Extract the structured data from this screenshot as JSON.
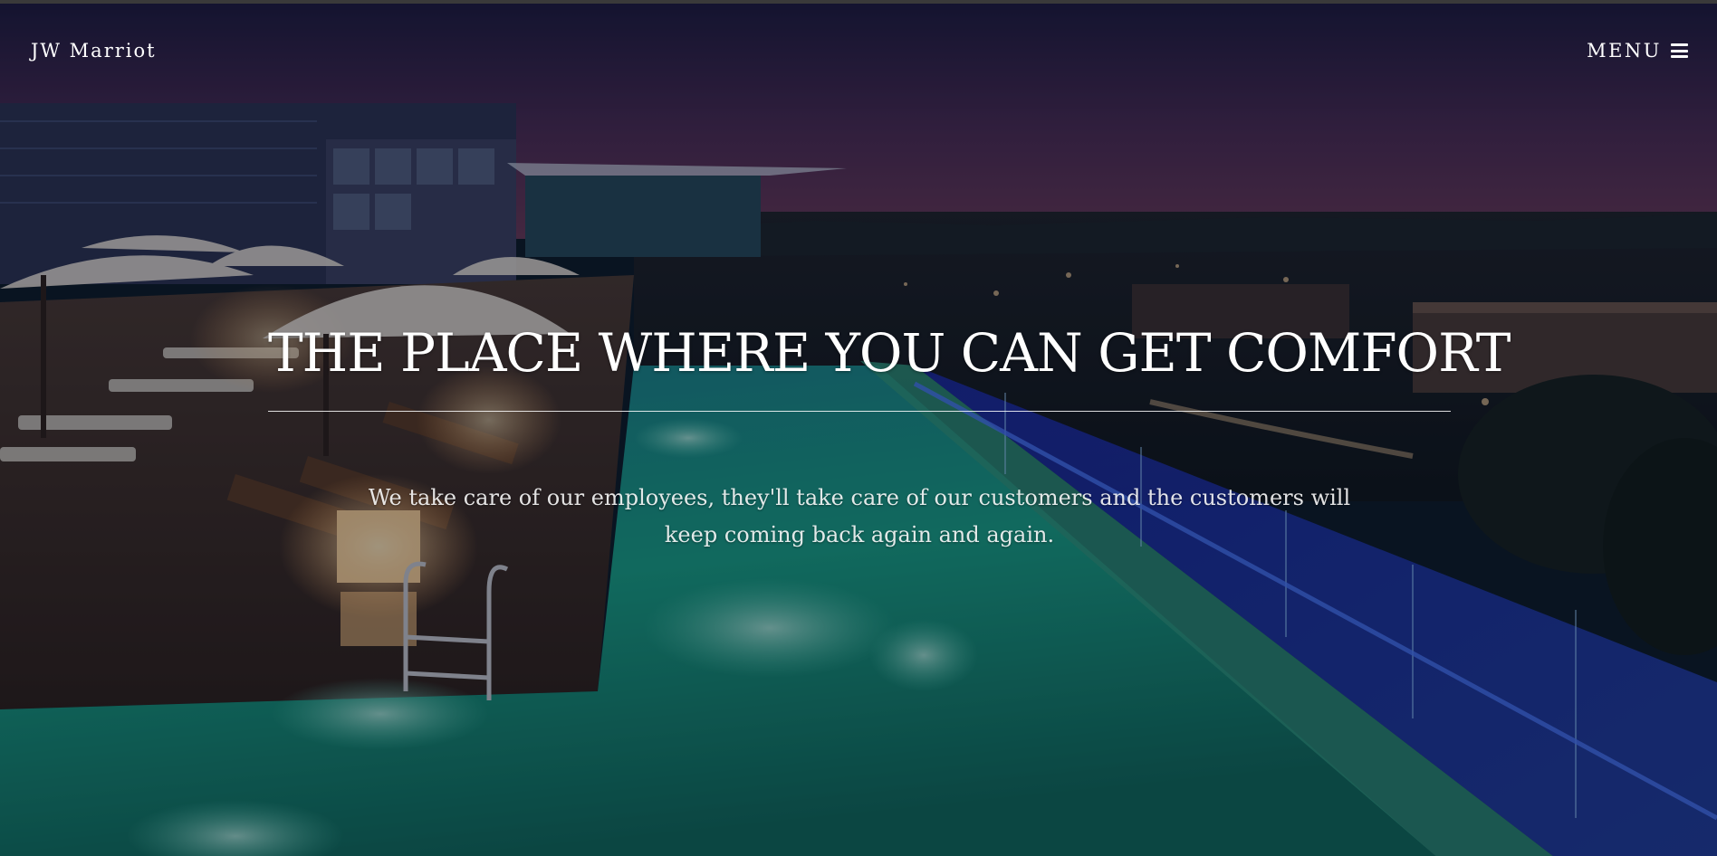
{
  "nav": {
    "brand": "JW Marriot",
    "menu_label": "MENU",
    "menu_icon": "hamburger-icon"
  },
  "hero": {
    "headline": "THE PLACE WHERE YOU CAN GET COMFORT",
    "tagline": "We take care of our employees, they'll take care of our customers and the customers will keep coming back again and again.",
    "background_image": "rooftop infinity pool at dusk with loungers, umbrellas and city lights"
  },
  "colors": {
    "text": "#ffffff",
    "pool": "#1fa88a",
    "sky": "#3a2a52"
  }
}
